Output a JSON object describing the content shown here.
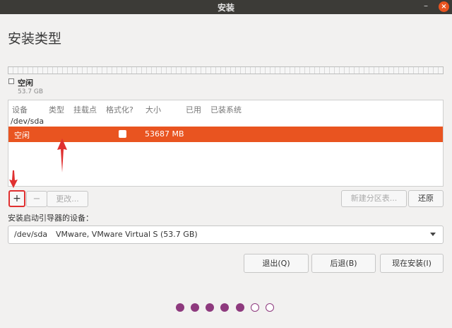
{
  "window": {
    "title": "安装",
    "minimize": "–",
    "close": "×"
  },
  "page": {
    "title": "安装类型"
  },
  "legend": {
    "label": "空闲",
    "size": "53.7 GB"
  },
  "table": {
    "headers": [
      "设备",
      "类型",
      "挂载点",
      "格式化?",
      "大小",
      "已用",
      "已装系统"
    ],
    "device": "/dev/sda",
    "selected_row": {
      "device": "空闲",
      "format": false,
      "size": "53687 MB"
    }
  },
  "toolbar": {
    "add": "+",
    "remove": "−",
    "change": "更改...",
    "new_table": "新建分区表...",
    "revert": "还原"
  },
  "boot": {
    "label": "安装启动引导器的设备：",
    "device": "/dev/sda",
    "description": "VMware, VMware Virtual S (53.7 GB)"
  },
  "buttons": {
    "quit": "退出(Q)",
    "back": "后退(B)",
    "install": "现在安装(I)"
  },
  "progress": {
    "total_steps": 7,
    "completed_steps": 5
  },
  "colors": {
    "accent": "#e95420",
    "progress": "#8e3a7e",
    "annotation": "#e03030"
  }
}
